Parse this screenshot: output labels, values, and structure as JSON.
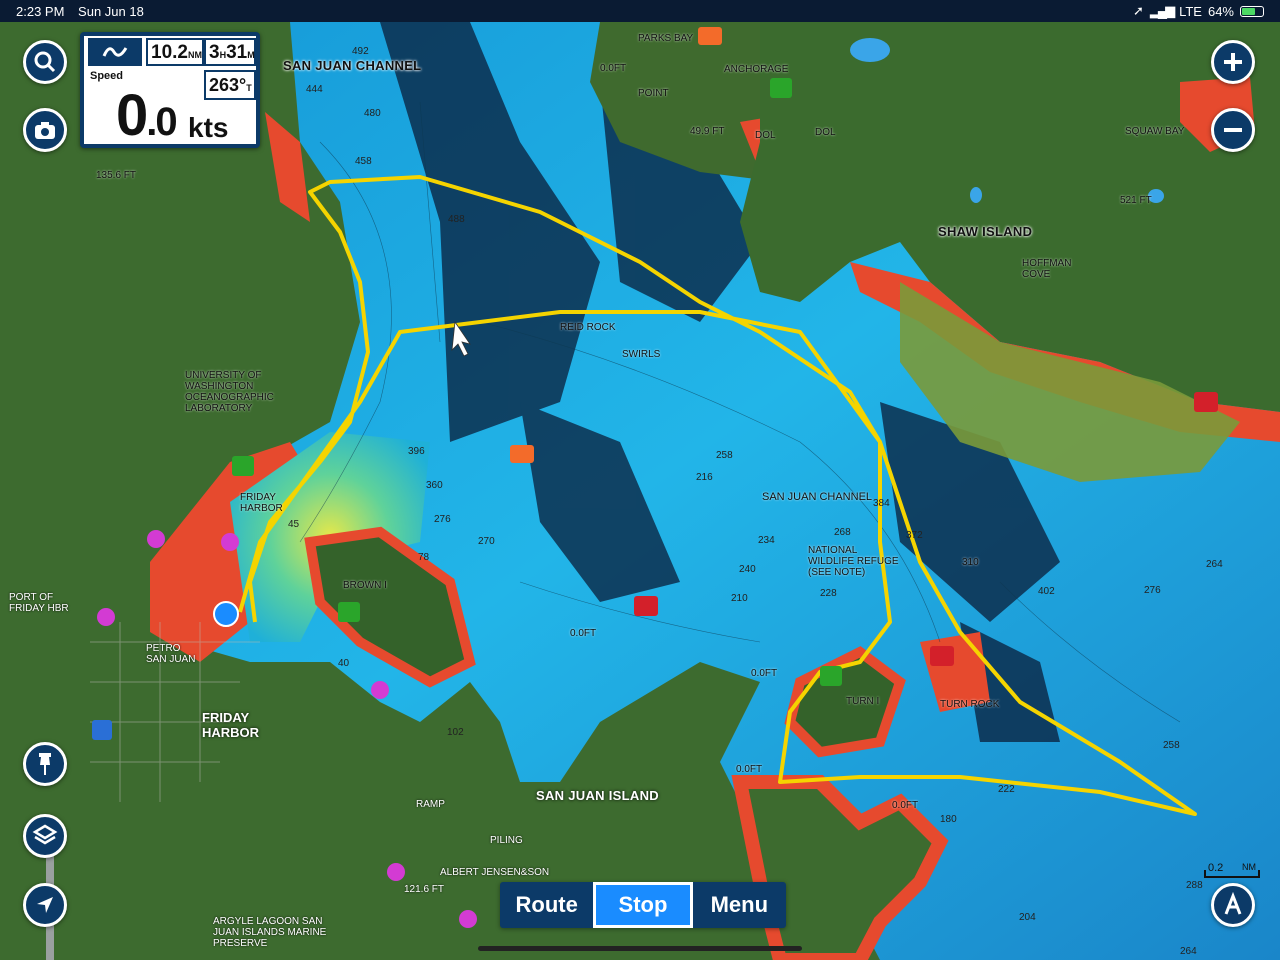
{
  "status": {
    "time": "2:23 PM",
    "date": "Sun Jun 18",
    "network": "LTE",
    "battery": "64%",
    "battery_level": 0.64
  },
  "instrument": {
    "distance_value": "10.2",
    "distance_unit": "NM",
    "time_h": "3",
    "time_h_unit": "H",
    "time_m": "31",
    "time_m_unit": "M",
    "speed_label": "Speed",
    "speed_int": "0",
    "speed_dec": ".0",
    "speed_unit": "kts",
    "heading_value": "263°",
    "heading_ref": "T"
  },
  "controls": {
    "search_icon": "search-icon",
    "camera_icon": "camera-icon",
    "zoom_in_icon": "plus-icon",
    "zoom_out_icon": "minus-icon",
    "pin_icon": "pushpin-icon",
    "layers_icon": "layers-icon",
    "locate_icon": "location-arrow-icon",
    "anchor_mode_icon": "compass-a-icon"
  },
  "bottom_bar": {
    "route": "Route",
    "stop": "Stop",
    "menu": "Menu"
  },
  "scale": {
    "value": "0.2",
    "unit": "NM"
  },
  "map_labels": {
    "san_juan_channel_top": "SAN JUAN CHANNEL",
    "parks_bay": "PARKS BAY",
    "anchorage": "ANCHORAGE",
    "point": "POINT",
    "dol1": "DOL",
    "dol2": "DOL",
    "depth_49": "49.9 FT",
    "zero_ft_top": "0.0FT",
    "squaw_bay": "SQUAW BAY",
    "shaw_island": "SHAW ISLAND",
    "hoffman_cove": "HOFFMAN\nCOVE",
    "depth_521": "521 FT",
    "depth_1356": "135.6 FT",
    "uw_lab": "UNIVERSITY OF\nWASHINGTON\nOCEANOGRAPHIC\nLABORATORY",
    "friday_harbor_small": "FRIDAY\nHARBOR",
    "port_of_friday": "PORT OF\nFRIDAY HBR",
    "petro": "PETRO\nSAN JUAN",
    "friday_harbor_town": "FRIDAY\nHARBOR",
    "brown_i": "BROWN I",
    "swirls": "SWIRLS",
    "reid_rock": "REID ROCK",
    "san_juan_channel_mid": "SAN JUAN CHANNEL",
    "national_wildlife": "NATIONAL\nWILDLIFE REFUGE\n(SEE NOTE)",
    "turn_i": "TURN I",
    "turn_rock": "TURN ROCK",
    "zero_ft_turn": "0.0FT",
    "zero_ft_mid": "0.0FT",
    "zero_ft_low": "0.0FT",
    "zero_ft_se": "0.0FT",
    "depth_310": "310",
    "san_juan_island": "SAN JUAN ISLAND",
    "piling": "PILING",
    "albert_jensen": "ALBERT JENSEN&SON",
    "depth_1216": "121.6 FT",
    "argyle": "ARGYLE LAGOON SAN\nJUAN ISLANDS MARINE\nPRESERVE",
    "ramp": "RAMP"
  },
  "depth_soundings": [
    "492",
    "444",
    "480",
    "458",
    "488",
    "396",
    "360",
    "276",
    "270",
    "216",
    "258",
    "234",
    "240",
    "210",
    "228",
    "268",
    "384",
    "372",
    "402",
    "276",
    "264",
    "258",
    "222",
    "288",
    "264",
    "204",
    "180",
    "102",
    "78",
    "45",
    "40"
  ],
  "colors": {
    "accent": "#0c3a68",
    "active": "#1a8cff",
    "track": "#f5d400",
    "land": "#3f6a2e",
    "shallow": "#e8412c",
    "deep": "#1fa6dd"
  }
}
